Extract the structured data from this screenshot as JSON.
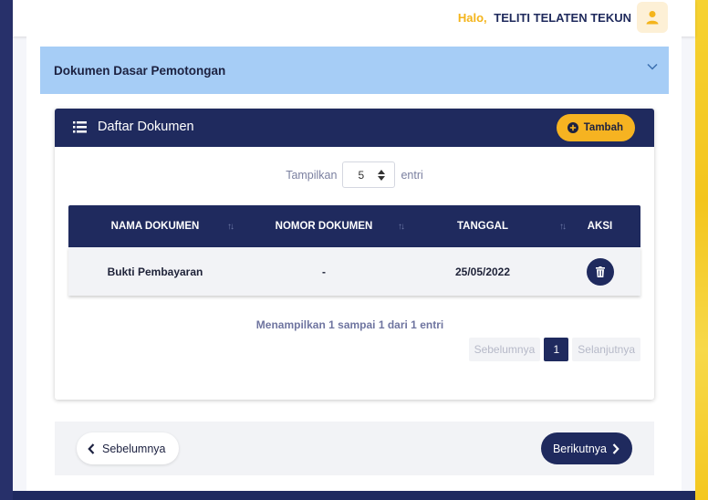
{
  "header": {
    "greeting": "Halo,",
    "user_name": "TELITI TELATEN TEKUN",
    "avatar_icon": "user-icon"
  },
  "accordion": {
    "title": "Dokumen Dasar Pemotongan",
    "icon": "chevron-down-icon"
  },
  "documents": {
    "title": "Daftar Dokumen",
    "add_button": "Tambah",
    "show_label": "Tampilkan",
    "show_value": "5",
    "entries_label": "entri",
    "columns": [
      "NAMA DOKUMEN",
      "NOMOR DOKUMEN",
      "TANGGAL",
      "AKSI"
    ],
    "rows": [
      {
        "name": "Bukti Pembayaran",
        "number": "-",
        "date": "25/05/2022",
        "action_icon": "trash-icon"
      }
    ],
    "info": "Menampilkan 1 sampai 1 dari 1 entri",
    "pagination": {
      "prev": "Sebelumnya",
      "current": "1",
      "next": "Selanjutnya"
    }
  },
  "nav": {
    "prev_label": "Sebelumnya",
    "next_label": "Berikutnya"
  },
  "colors": {
    "navy": "#1f2a5e",
    "accent": "#f6b321",
    "accordion_bg": "#a6cdf6"
  }
}
